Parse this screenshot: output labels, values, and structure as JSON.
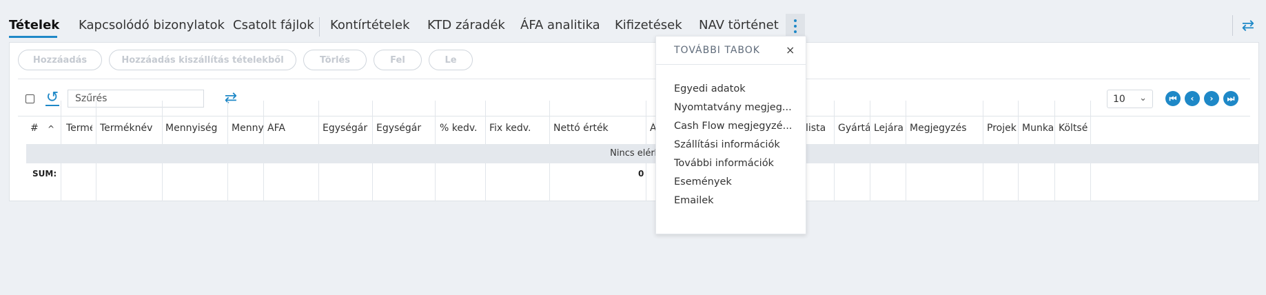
{
  "tabs": {
    "items": [
      "Tételek",
      "Kapcsolódó bizonylatok",
      "Csatolt fájlok",
      "Kontírtételek",
      "KTD záradék",
      "ÁFA analitika",
      "Kifizetések",
      "NAV történet"
    ],
    "active_index": 0
  },
  "toolbar": {
    "buttons": [
      "Hozzáadás",
      "Hozzáadás kiszállítás tételekből",
      "Törlés",
      "Fel",
      "Le"
    ],
    "filter_placeholder": "Szűrés",
    "page_size": "10"
  },
  "table": {
    "columns": [
      "#",
      "Termé",
      "Terméknév",
      "Mennyiség",
      "Menny",
      "ÁFA",
      "Egységár",
      "Egységár",
      "% kedv.",
      "Fix kedv.",
      "Nettó érték",
      "Á",
      "lista",
      "Gyártá",
      "Lejára",
      "Megjegyzés",
      "Projek",
      "Munka",
      "Költsé"
    ],
    "empty_text": "Nincs elérhető",
    "sum_label": "SUM:",
    "sum_value": "0"
  },
  "more_tabs_popup": {
    "title": "TOVÁBBI TABOK",
    "close": "×",
    "items": [
      "Egyedi adatok",
      "Nyomtatvány megjeg...",
      "Cash Flow megjegyzé...",
      "Szállítási információk",
      "További információk",
      "Események",
      "Emailek"
    ]
  },
  "icons": {
    "swap": "⇄",
    "refresh": "↺",
    "caret": "⌄",
    "first": "⏮",
    "prev": "‹",
    "next": "›",
    "last": "⏭"
  },
  "colors": {
    "accent": "#1e88c7",
    "background": "#edf0f4"
  }
}
